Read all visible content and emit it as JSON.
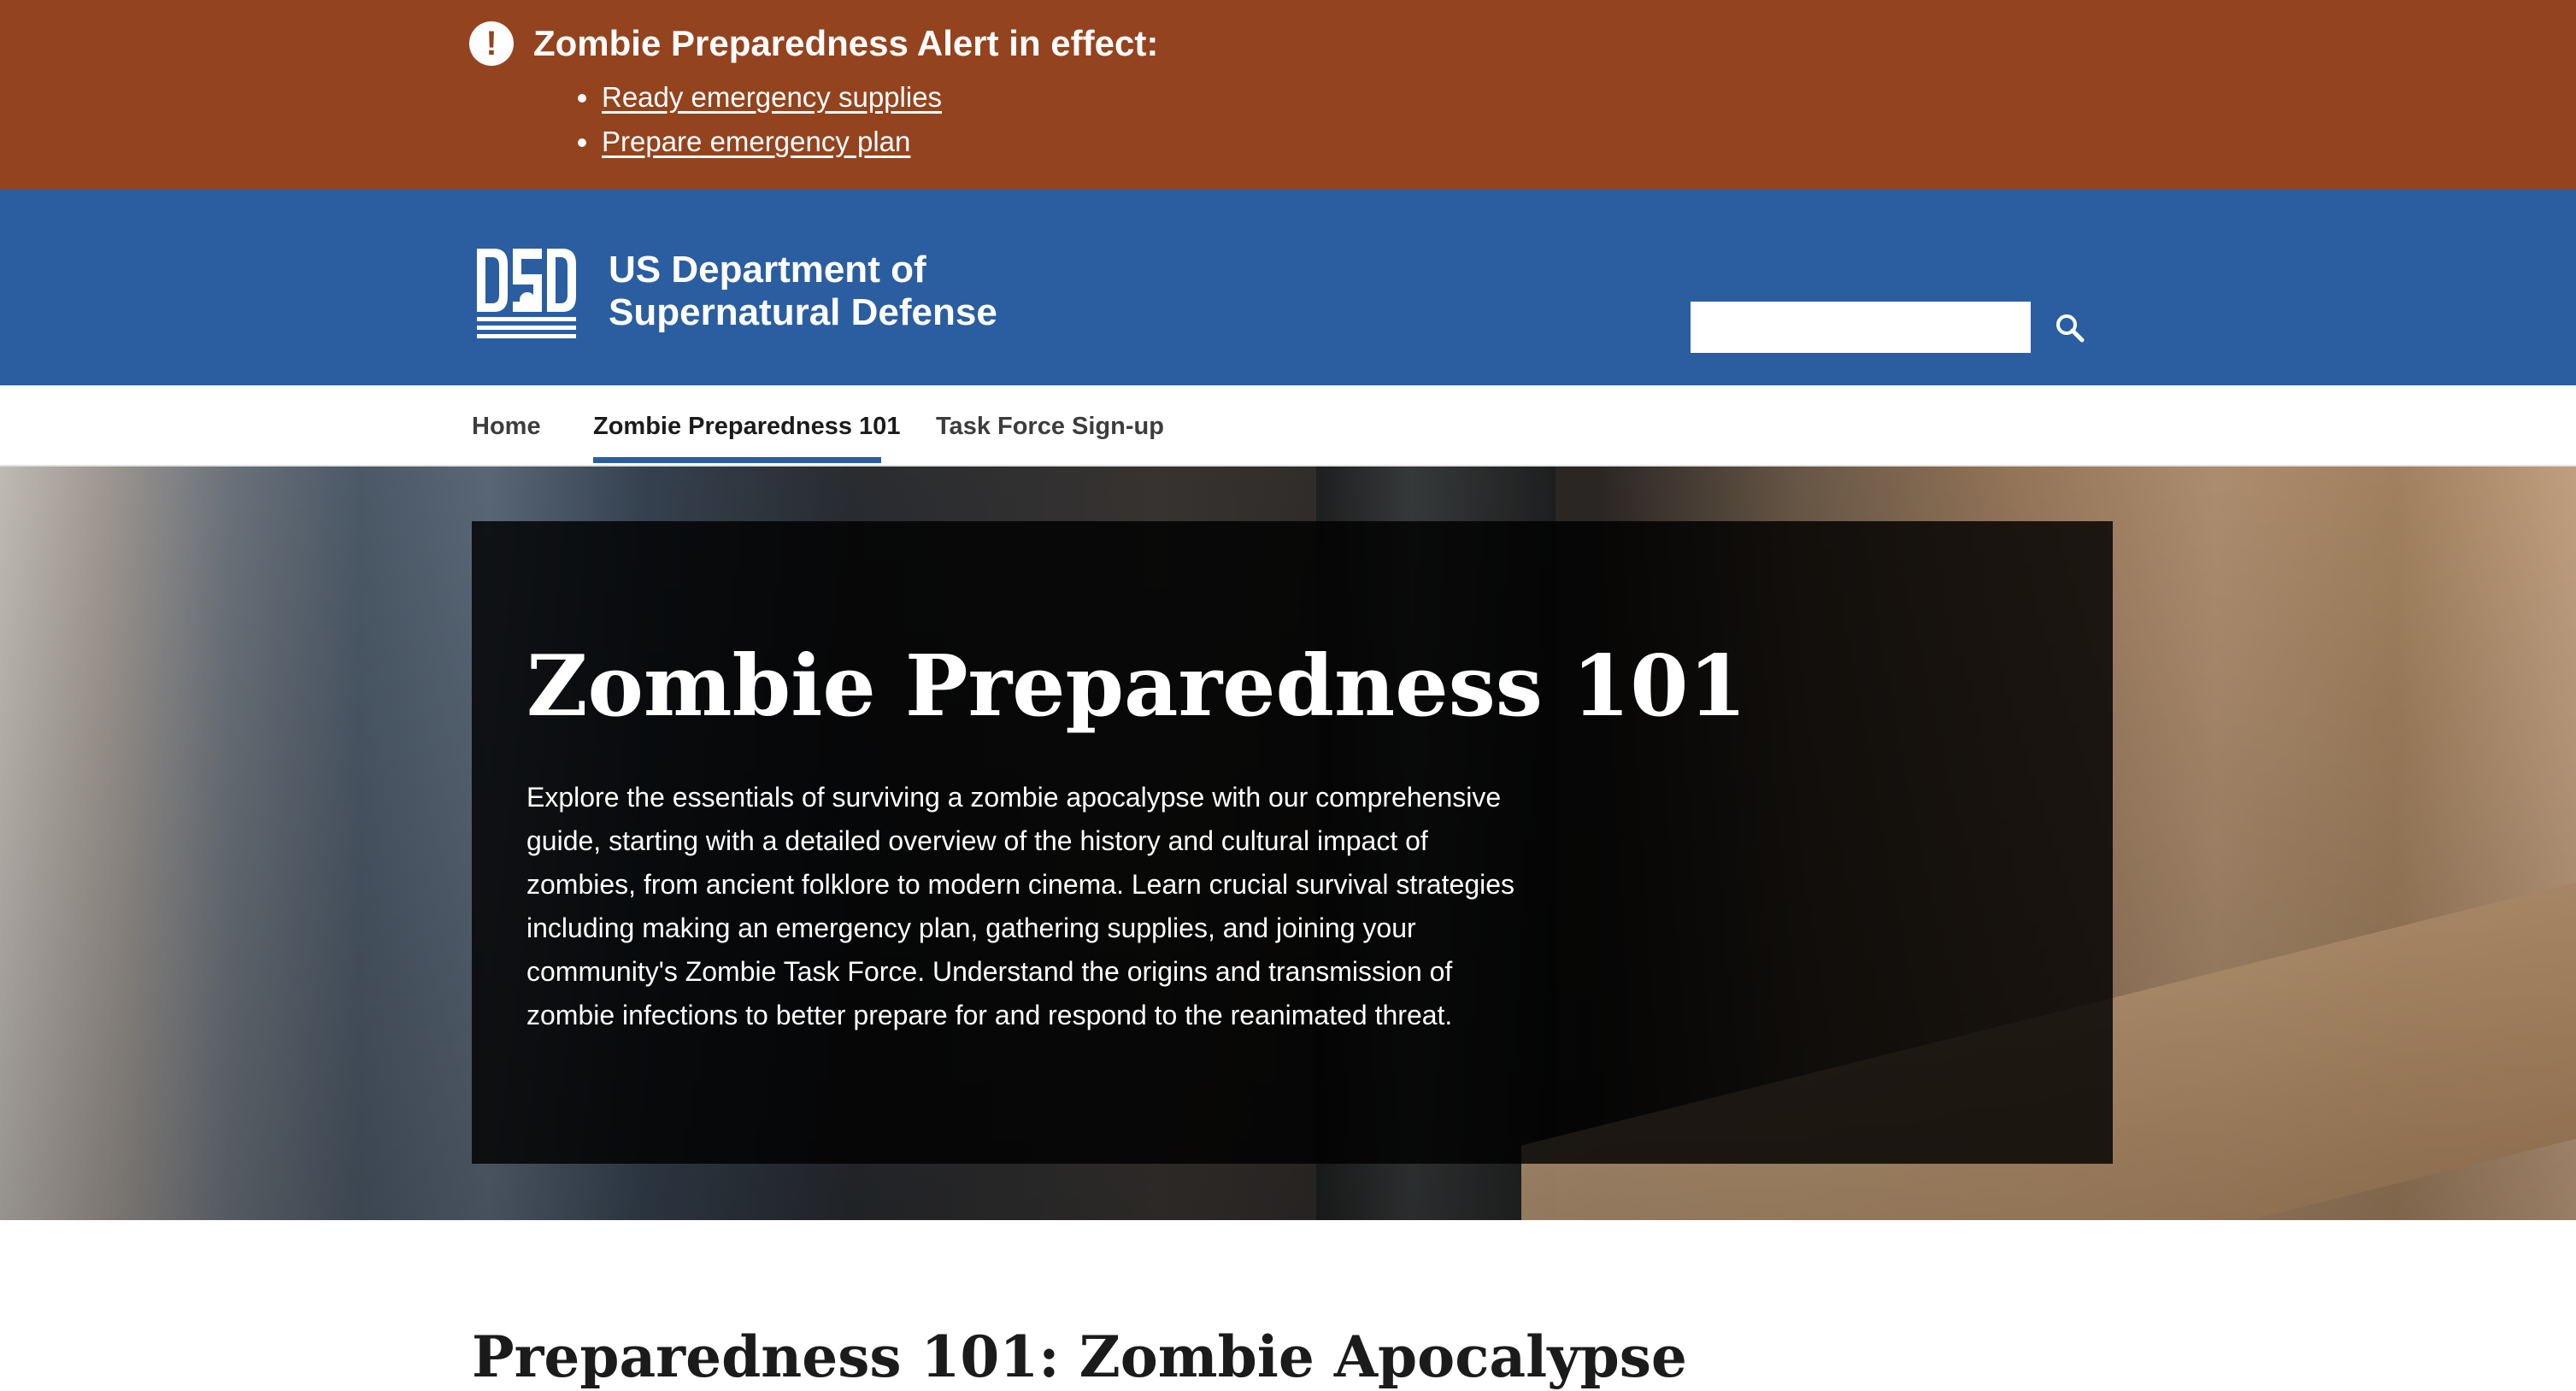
{
  "alert": {
    "icon": "exclamation-circle-icon",
    "heading": "Zombie Preparedness Alert in effect:",
    "links": [
      {
        "label": "Ready emergency supplies"
      },
      {
        "label": "Prepare emergency plan"
      }
    ]
  },
  "header": {
    "logo_text": "DSD",
    "agency_name_line1": "US Department of",
    "agency_name_line2": "Supernatural Defense",
    "search": {
      "value": "",
      "placeholder": "",
      "button_icon": "search-icon"
    }
  },
  "nav": {
    "items": [
      {
        "label": "Home",
        "active": false
      },
      {
        "label": "Zombie Preparedness 101",
        "active": true
      },
      {
        "label": "Task Force Sign-up",
        "active": false
      }
    ]
  },
  "hero": {
    "title": "Zombie Preparedness 101",
    "text": "Explore the essentials of surviving a zombie apocalypse with our comprehensive guide, starting with a detailed overview of the history and cultural impact of zombies, from ancient folklore to modern cinema. Learn crucial survival strategies including making an emergency plan, gathering supplies, and joining your community's Zombie Task Force. Understand the origins and transmission of zombie infections to better prepare for and respond to the reanimated threat."
  },
  "main": {
    "section_heading": "Preparedness 101: Zombie Apocalypse"
  },
  "colors": {
    "alert_bg": "#94431f",
    "header_bg": "#2a5ea0",
    "nav_active_underline": "#2a5ea0",
    "hero_card_bg": "rgba(0,0,0,0.82)"
  }
}
